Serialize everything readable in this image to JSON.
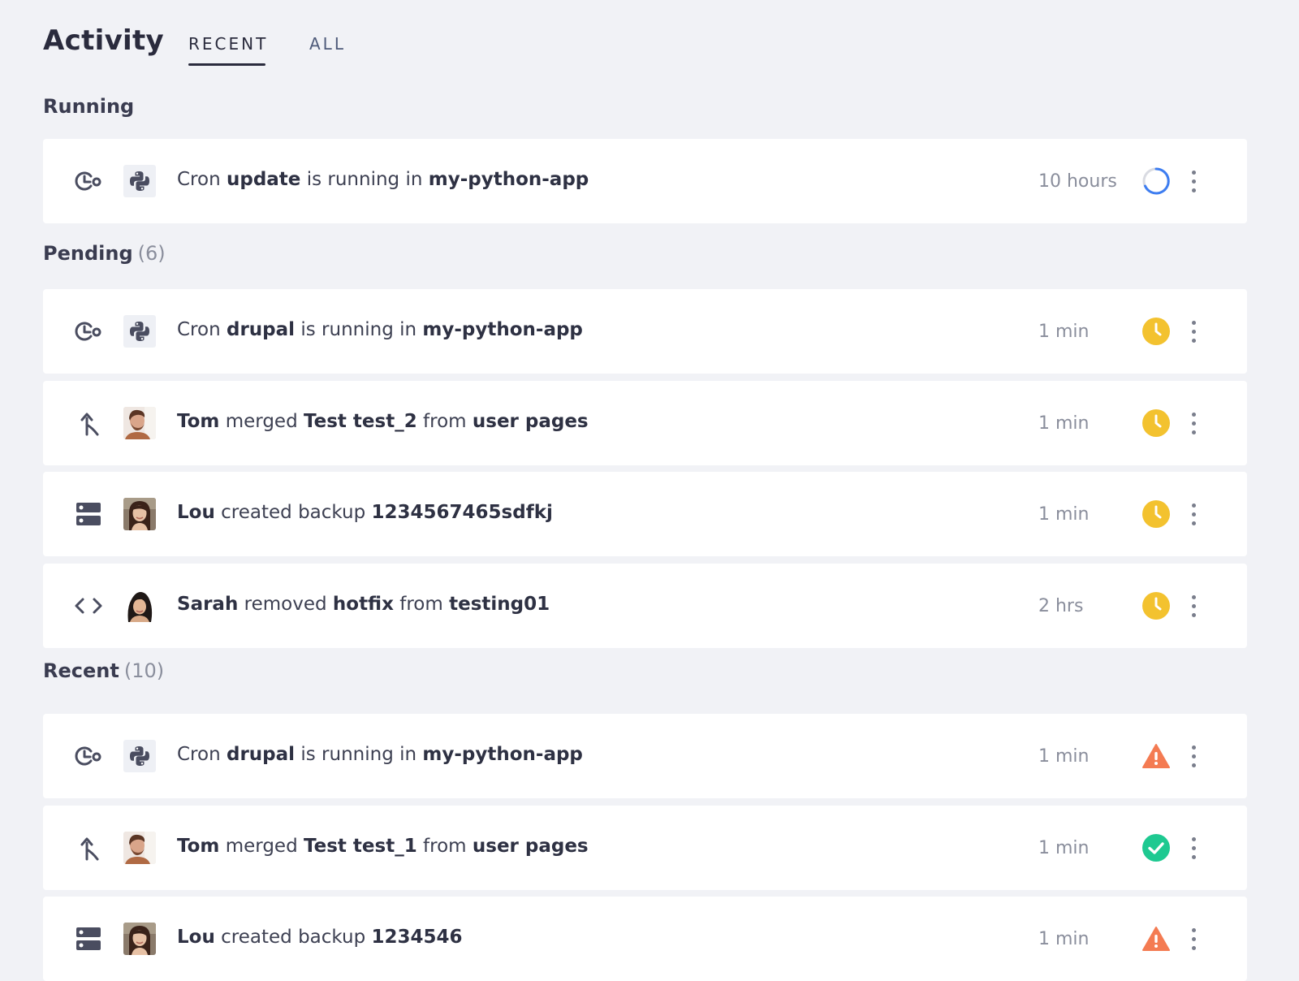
{
  "header": {
    "title": "Activity",
    "tabs": [
      {
        "label": "RECENT",
        "active": true
      },
      {
        "label": "ALL",
        "active": false
      }
    ]
  },
  "colors": {
    "background": "#f1f2f6",
    "card": "#ffffff",
    "pending": "#f3c22f",
    "warning": "#f47b52",
    "success": "#1ec991",
    "running": "#3d7df1"
  },
  "sections": [
    {
      "title": "Running",
      "count": "",
      "items": [
        {
          "type_icon": "cron-icon",
          "avatar": "python-logo",
          "parts": [
            {
              "t": "Cron ",
              "b": false
            },
            {
              "t": "update",
              "b": true
            },
            {
              "t": " is running in ",
              "b": false
            },
            {
              "t": "my-python-app",
              "b": true
            }
          ],
          "time": "10 hours",
          "status": "running-spinner-icon"
        }
      ]
    },
    {
      "title": "Pending",
      "count": "(6)",
      "items": [
        {
          "type_icon": "cron-icon",
          "avatar": "python-logo",
          "parts": [
            {
              "t": "Cron ",
              "b": false
            },
            {
              "t": "drupal",
              "b": true
            },
            {
              "t": " is running in ",
              "b": false
            },
            {
              "t": "my-python-app",
              "b": true
            }
          ],
          "time": "1 min",
          "status": "pending-clock-icon"
        },
        {
          "type_icon": "merge-icon",
          "avatar": "avatar-tom",
          "parts": [
            {
              "t": "Tom",
              "b": true
            },
            {
              "t": " merged ",
              "b": false
            },
            {
              "t": "Test test_2",
              "b": true
            },
            {
              "t": " from ",
              "b": false
            },
            {
              "t": "user pages",
              "b": true
            }
          ],
          "time": "1 min",
          "status": "pending-clock-icon"
        },
        {
          "type_icon": "backup-server-icon",
          "avatar": "avatar-lou",
          "parts": [
            {
              "t": "Lou",
              "b": true
            },
            {
              "t": " created backup ",
              "b": false
            },
            {
              "t": "1234567465sdfkj",
              "b": true
            }
          ],
          "time": "1 min",
          "status": "pending-clock-icon"
        },
        {
          "type_icon": "code-icon",
          "avatar": "avatar-sarah",
          "parts": [
            {
              "t": "Sarah",
              "b": true
            },
            {
              "t": " removed ",
              "b": false
            },
            {
              "t": "hotfix",
              "b": true
            },
            {
              "t": " from ",
              "b": false
            },
            {
              "t": "testing01",
              "b": true
            }
          ],
          "time": "2 hrs",
          "status": "pending-clock-icon"
        }
      ]
    },
    {
      "title": "Recent",
      "count": "(10)",
      "items": [
        {
          "type_icon": "cron-icon",
          "avatar": "python-logo",
          "parts": [
            {
              "t": "Cron ",
              "b": false
            },
            {
              "t": "drupal",
              "b": true
            },
            {
              "t": " is running in ",
              "b": false
            },
            {
              "t": "my-python-app",
              "b": true
            }
          ],
          "time": "1 min",
          "status": "warning-icon"
        },
        {
          "type_icon": "merge-icon",
          "avatar": "avatar-tom",
          "parts": [
            {
              "t": "Tom",
              "b": true
            },
            {
              "t": " merged ",
              "b": false
            },
            {
              "t": "Test test_1",
              "b": true
            },
            {
              "t": " from ",
              "b": false
            },
            {
              "t": "user pages",
              "b": true
            }
          ],
          "time": "1 min",
          "status": "success-check-icon"
        },
        {
          "type_icon": "backup-server-icon",
          "avatar": "avatar-lou",
          "parts": [
            {
              "t": "Lou",
              "b": true
            },
            {
              "t": " created backup ",
              "b": false
            },
            {
              "t": "1234546",
              "b": true
            }
          ],
          "time": "1 min",
          "status": "warning-icon"
        }
      ]
    }
  ]
}
